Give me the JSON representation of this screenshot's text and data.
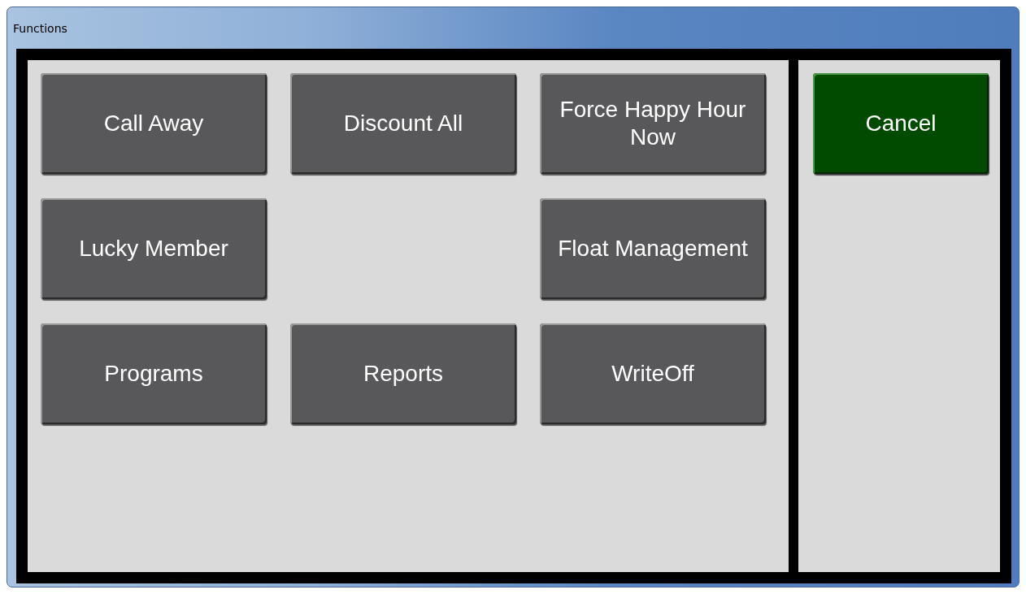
{
  "window": {
    "title": "Functions"
  },
  "function_buttons": [
    {
      "kind": "button",
      "label": "Call Away"
    },
    {
      "kind": "button",
      "label": "Discount All"
    },
    {
      "kind": "button",
      "label": "Force Happy Hour Now"
    },
    {
      "kind": "button",
      "label": "Lucky Member"
    },
    {
      "kind": "blank"
    },
    {
      "kind": "button",
      "label": "Float Management"
    },
    {
      "kind": "button",
      "label": "Programs"
    },
    {
      "kind": "button",
      "label": "Reports"
    },
    {
      "kind": "button",
      "label": "WriteOff"
    }
  ],
  "cancel_button": {
    "label": "Cancel"
  }
}
